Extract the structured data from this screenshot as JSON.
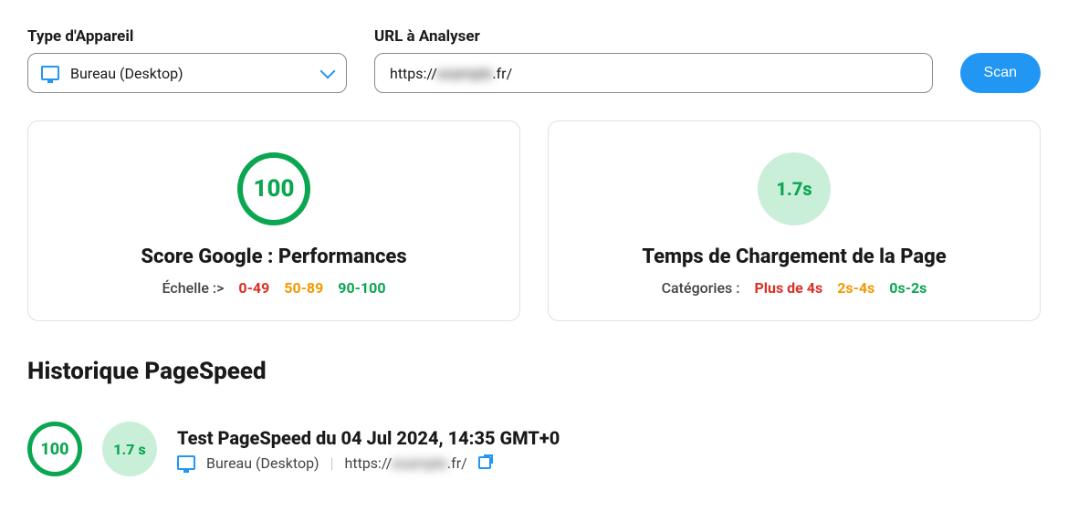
{
  "form": {
    "device_label": "Type d'Appareil",
    "device_value": "Bureau (Desktop)",
    "url_label": "URL à Analyser",
    "url_prefix": "https://",
    "url_hidden": "example",
    "url_suffix": ".fr/",
    "scan_button": "Scan"
  },
  "cards": {
    "score": {
      "value": "100",
      "title": "Score Google : Performances",
      "legend_label": "Échelle :>",
      "range_bad": "0-49",
      "range_mid": "50-89",
      "range_good": "90-100"
    },
    "load": {
      "value": "1.7s",
      "title": "Temps de Chargement de la Page",
      "legend_label": "Catégories :",
      "cat_bad": "Plus de 4s",
      "cat_mid": "2s-4s",
      "cat_good": "0s-2s"
    }
  },
  "history": {
    "title": "Historique PageSpeed",
    "items": [
      {
        "score": "100",
        "time": "1.7 s",
        "title": "Test PageSpeed du 04 Jul 2024, 14:35 GMT+0",
        "device": "Bureau (Desktop)",
        "url_prefix": "https://",
        "url_hidden": "example",
        "url_suffix": ".fr/"
      }
    ]
  }
}
